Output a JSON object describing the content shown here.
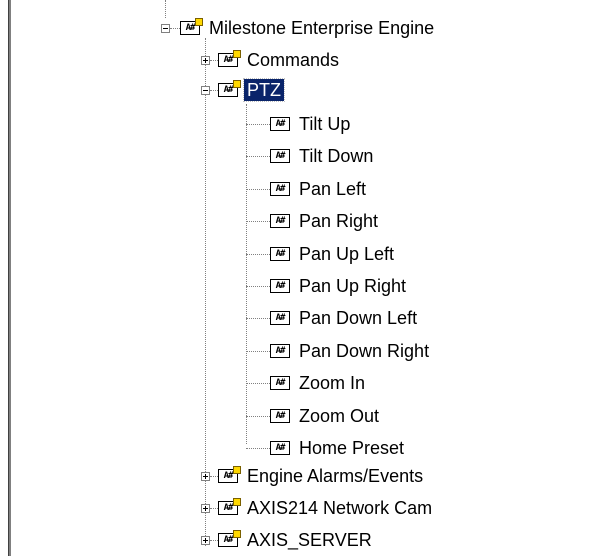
{
  "icon_glyph": "A#",
  "tree": {
    "root": {
      "label": "Milestone Enterprise Engine",
      "expanded": true
    },
    "commands": {
      "label": "Commands",
      "expanded": false
    },
    "ptz": {
      "label": "PTZ",
      "expanded": true,
      "selected": true,
      "children": [
        "Tilt Up",
        "Tilt Down",
        "Pan Left",
        "Pan Right",
        "Pan Up Left",
        "Pan Up Right",
        "Pan Down Left",
        "Pan Down Right",
        "Zoom In",
        "Zoom Out",
        "Home Preset"
      ]
    },
    "siblings": [
      "Engine Alarms/Events",
      "AXIS214 Network Cam",
      "AXIS_SERVER"
    ]
  },
  "colors": {
    "selection": "#0a246a",
    "tree_lines": "#808080",
    "folder_badge": "#ffd800"
  }
}
